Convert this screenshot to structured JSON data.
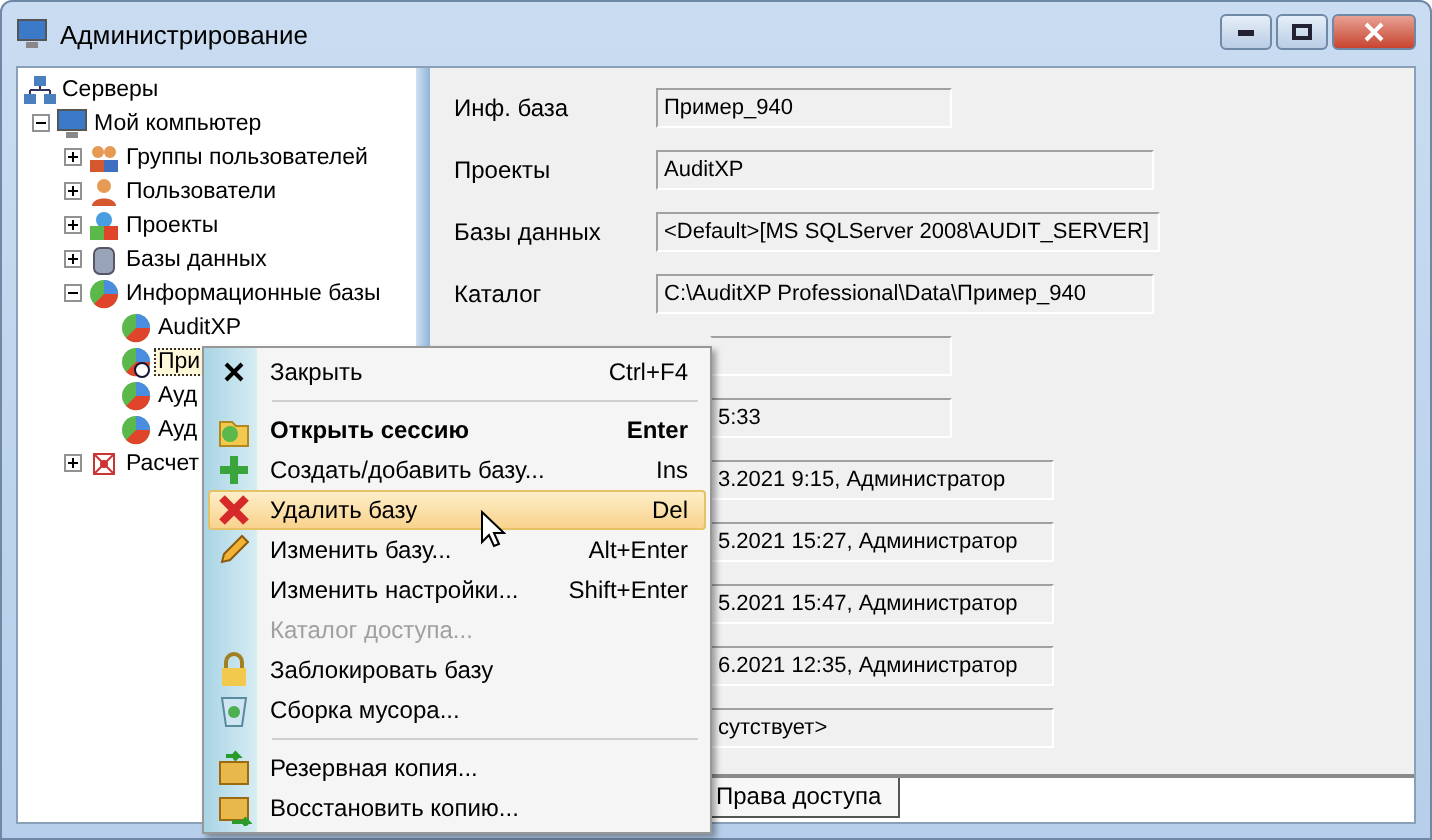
{
  "window": {
    "title": "Администрирование"
  },
  "tree": [
    {
      "label": "Серверы",
      "kind": "servers",
      "selected": false,
      "children": [
        {
          "label": "Мой компьютер",
          "kind": "computer",
          "expanded": true,
          "selected": false,
          "children": [
            {
              "label": "Группы пользователей",
              "kind": "groups",
              "expanded": false,
              "selected": false
            },
            {
              "label": "Пользователи",
              "kind": "user",
              "expanded": false,
              "selected": false
            },
            {
              "label": "Проекты",
              "kind": "projects",
              "expanded": false,
              "selected": false
            },
            {
              "label": "Базы данных",
              "kind": "database",
              "expanded": false,
              "selected": false
            },
            {
              "label": "Информационные базы",
              "kind": "infobase",
              "expanded": true,
              "selected": false,
              "children": [
                {
                  "label": "AuditXP",
                  "kind": "infobase",
                  "selected": false
                },
                {
                  "label": "При",
                  "kind": "infobase-active",
                  "selected": true
                },
                {
                  "label": "Ауд",
                  "kind": "infobase",
                  "selected": false
                },
                {
                  "label": "Ауд",
                  "kind": "infobase",
                  "selected": false
                }
              ]
            },
            {
              "label": "Расчет",
              "kind": "calc",
              "expanded": false,
              "selected": false
            }
          ]
        }
      ]
    }
  ],
  "fields": [
    {
      "label": "Инф. база",
      "value": "Пример_940",
      "kind": "short",
      "covered": false
    },
    {
      "label": "Проекты",
      "value": "AuditXP",
      "kind": "long",
      "covered": false
    },
    {
      "label": "Базы данных",
      "value": "<Default>[MS SQLServer 2008\\AUDIT_SERVER]",
      "kind": "long",
      "covered": false
    },
    {
      "label": "Каталог",
      "value": "C:\\AuditXP Professional\\Data\\Пример_940",
      "kind": "long",
      "covered": false
    },
    {
      "kind": "short",
      "covered": true
    },
    {
      "value": "5:33",
      "kind": "short",
      "covered": true
    },
    {
      "value": "3.2021 9:15, Администратор",
      "kind": "medium",
      "covered": true
    },
    {
      "value": "5.2021 15:27, Администратор",
      "kind": "medium",
      "covered": true
    },
    {
      "value": "5.2021 15:47, Администратор",
      "kind": "medium",
      "covered": true
    },
    {
      "value": "6.2021 12:35, Администратор",
      "kind": "medium",
      "covered": true
    },
    {
      "value": "сутствует>",
      "kind": "medium",
      "covered": true
    }
  ],
  "tabs": [
    {
      "label": "Права доступа",
      "selected": false
    }
  ],
  "context_menu": [
    {
      "kind": "close",
      "label": "Закрыть",
      "shortcut": "Ctrl+F4",
      "bold": false,
      "disabled": false,
      "selected": false
    },
    {
      "kind": "separator"
    },
    {
      "kind": "open",
      "label": "Открыть сессию",
      "shortcut": "Enter",
      "bold": true,
      "disabled": false,
      "selected": false
    },
    {
      "kind": "add",
      "label": "Создать/добавить базу...",
      "shortcut": "Ins",
      "bold": false,
      "disabled": false,
      "selected": false
    },
    {
      "kind": "delete",
      "label": "Удалить базу",
      "shortcut": "Del",
      "bold": false,
      "disabled": false,
      "selected": true
    },
    {
      "kind": "edit",
      "label": "Изменить базу...",
      "shortcut": "Alt+Enter",
      "bold": false,
      "disabled": false,
      "selected": false
    },
    {
      "kind": "plain",
      "label": "Изменить настройки...",
      "shortcut": "Shift+Enter",
      "bold": false,
      "disabled": false,
      "selected": false
    },
    {
      "kind": "plain",
      "label": "Каталог доступа...",
      "bold": false,
      "disabled": true,
      "selected": false
    },
    {
      "kind": "lock",
      "label": "Заблокировать базу",
      "bold": false,
      "disabled": false,
      "selected": false
    },
    {
      "kind": "trash",
      "label": "Сборка мусора...",
      "bold": false,
      "disabled": false,
      "selected": false
    },
    {
      "kind": "separator"
    },
    {
      "kind": "backup",
      "label": "Резервная копия...",
      "bold": false,
      "disabled": false,
      "selected": false
    },
    {
      "kind": "restore",
      "label": "Восстановить копию...",
      "bold": false,
      "disabled": false,
      "selected": false
    }
  ]
}
